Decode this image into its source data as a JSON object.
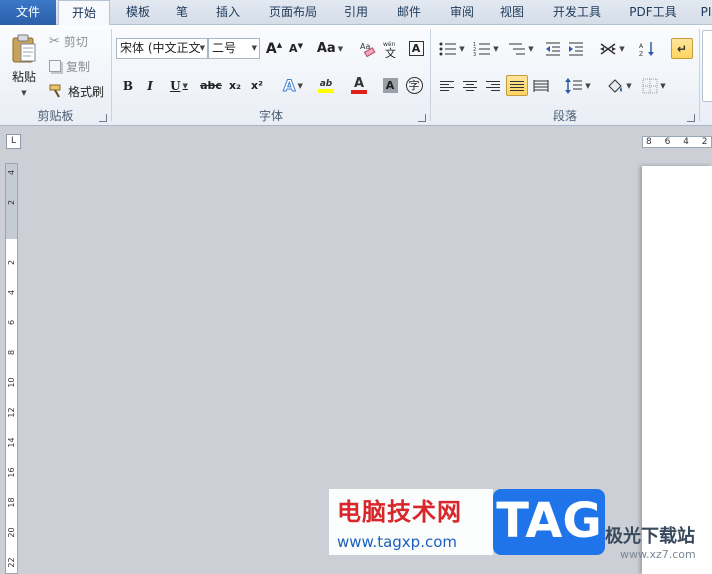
{
  "tabs": [
    {
      "label": "文件",
      "left": 0
    },
    {
      "label": "开始"
    },
    {
      "label": "模板"
    },
    {
      "label": "笔"
    },
    {
      "label": "插入"
    },
    {
      "label": "页面布局"
    },
    {
      "label": "引用"
    },
    {
      "label": "邮件"
    },
    {
      "label": "审阅"
    },
    {
      "label": "视图"
    },
    {
      "label": "开发工具"
    },
    {
      "label": "PDF工具"
    },
    {
      "label": "PI"
    }
  ],
  "clipboard": {
    "paste_label": "粘贴",
    "cut_label": "剪切",
    "copy_label": "复制",
    "format_painter_label": "格式刷",
    "group_label": "剪贴板"
  },
  "font": {
    "family_value": "宋体 (中文正文",
    "size_value": "二号",
    "grow_label": "A",
    "shrink_label": "A",
    "case_label": "Aa",
    "bold_label": "B",
    "italic_label": "I",
    "underline_label": "U",
    "strike_label": "abc",
    "subscript_label": "x₂",
    "superscript_label": "x²",
    "text_effect_label": "A",
    "highlight_label": "ab",
    "font_color_label": "A",
    "shade_label": "A",
    "enclose_label": "字",
    "group_label": "字体"
  },
  "paragraph": {
    "group_label": "段落"
  },
  "ruler": {
    "corner_label": "L",
    "horizontal_numbers": "8 6 4 2",
    "vertical_numbers": [
      "4",
      "2",
      "2",
      "4",
      "6",
      "8",
      "10",
      "12",
      "14",
      "16",
      "18",
      "20",
      "22"
    ]
  },
  "watermark": {
    "title": "电脑技术网",
    "url": "www.tagxp.com",
    "badge": "TAG",
    "site": "极光下载站",
    "site_url": "www.xz7.com"
  },
  "colors": {
    "file_tab": "#2a5fa8",
    "active_toggle": "#ffd45f",
    "highlight_yellow": "#ffff00",
    "font_red": "#e0201b"
  }
}
